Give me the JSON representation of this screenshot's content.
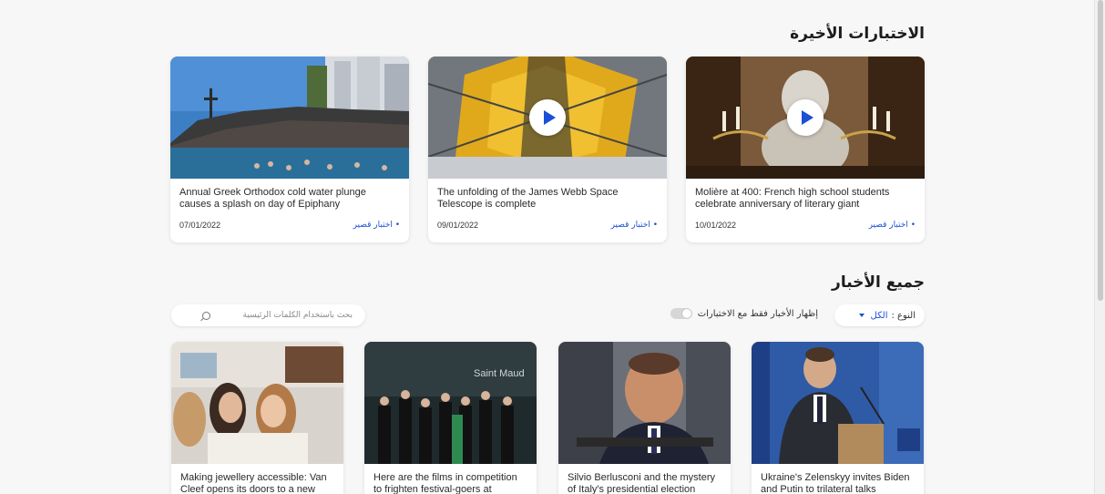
{
  "sections": {
    "latest_title": "الاختبارات الأخيرة",
    "all_news_title": "جميع الأخبار"
  },
  "video_cards": [
    {
      "title": "Annual Greek Orthodox cold water plunge causes a splash on day of Epiphany",
      "tag": "• اختبار قصير",
      "date": "07/01/2022",
      "has_play": false
    },
    {
      "title": "The unfolding of the James Webb Space Telescope is complete",
      "tag": "• اختبار قصير",
      "date": "09/01/2022",
      "has_play": true
    },
    {
      "title": "Molière at 400: French high school students celebrate anniversary of literary giant",
      "tag": "• اختبار قصير",
      "date": "10/01/2022",
      "has_play": true
    }
  ],
  "filters": {
    "type_label": "النوع :",
    "type_value": "الكل",
    "toggle_label": "إظهار الأخبار فقط مع الاختبارات",
    "toggle_on": false,
    "search_placeholder": "بحث باستخدام الكلمات الرئيسية"
  },
  "news_cards": [
    {
      "title": "Making jewellery accessible: Van Cleef opens its doors to a new"
    },
    {
      "title": "Here are the films in competition to frighten festival-goers at"
    },
    {
      "title": "Silvio Berlusconi and the mystery of Italy's presidential election"
    },
    {
      "title": "Ukraine's Zelenskyy invites Biden and Putin to trilateral talks"
    }
  ],
  "image_text": {
    "saint_maud": "Saint Maud"
  },
  "colors": {
    "accent": "#1b4fd6",
    "background": "#f7f7f7"
  }
}
